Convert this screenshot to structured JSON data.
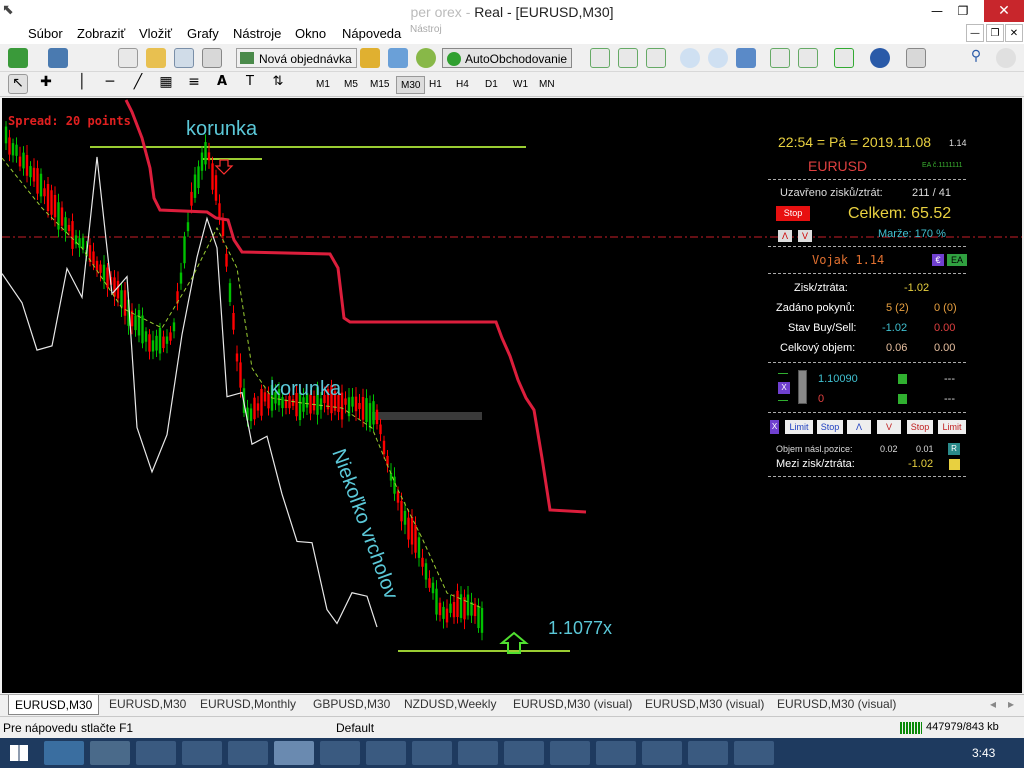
{
  "window": {
    "title_fragment": "Real - [EURUSD,M30]",
    "title_prefix": "per orex -"
  },
  "menu": [
    "Súbor",
    "Zobraziť",
    "Vložiť",
    "Grafy",
    "Nástroje",
    "Okno",
    "Nápoveda"
  ],
  "menu_ghost": "Nástroj",
  "toolbar": {
    "new_order": "Nová objednávka",
    "autotrading": "AutoObchodovanie"
  },
  "timeframes": [
    "M1",
    "M5",
    "M15",
    "M30",
    "H1",
    "H4",
    "D1",
    "W1",
    "MN"
  ],
  "timeframe_selected": "M30",
  "chart": {
    "spread": "Spread: 20 points",
    "annotations": {
      "korunka1": "korunka",
      "korunka2": "korunka",
      "vertical": "Niekoľko vrcholov",
      "price": "1.1077x"
    }
  },
  "panel": {
    "time": "22:54 = Pá = 2019.11.08",
    "version_small": "1.14",
    "symbol": "EURUSD",
    "ea_id": "EA č.1111111",
    "closed_label": "Uzavřeno zisků/ztrát:",
    "closed_value": "211 / 41",
    "stop_btn": "Stop",
    "total": "Celkem: 65.52",
    "a_btn": "Λ",
    "v_btn": "V",
    "margin": "Marže: 170 %",
    "vojak": "Vojak 1.14",
    "e_btn": "€",
    "ea_btn": "EA",
    "pl_label": "Zisk/ztráta:",
    "pl_value": "-1.02",
    "orders_label": "Zadáno pokynů:",
    "orders_buy": "5 (2)",
    "orders_sell": "0 (0)",
    "state_label": "Stav Buy/Sell:",
    "state_buy": "-1.02",
    "state_sell": "0.00",
    "volume_label": "Celkový objem:",
    "volume_buy": "0.06",
    "volume_sell": "0.00",
    "x_btn": "X",
    "line1_value": "1.10090",
    "line1_right": "---",
    "line2_value": "0",
    "line2_right": "---",
    "btns": [
      "X",
      "Limit",
      "Stop",
      "Λ",
      "V",
      "Stop",
      "Limit"
    ],
    "next_vol_label": "Objem násl.pozice:",
    "next_vol_a": "0.02",
    "next_vol_b": "0.01",
    "r_btn": "R",
    "between_label": "Mezi zisk/ztráta:",
    "between_value": "-1.02"
  },
  "tabs": [
    "EURUSD,M30",
    "EURUSD,M30",
    "EURUSD,Monthly",
    "GBPUSD,M30",
    "NZDUSD,Weekly",
    "EURUSD,M30 (visual)",
    "EURUSD,M30 (visual)",
    "EURUSD,M30 (visual)"
  ],
  "status": {
    "help": "Pre nápovedu stlačte F1",
    "profile": "Default",
    "traffic": "447979/843 kb"
  },
  "taskbar": {
    "clock": "3:43"
  },
  "colors": {
    "chart_bg": "#000000",
    "bull": "#00c000",
    "bear": "#ff0000",
    "trail": "#dc1e3c",
    "level": "#9acd32",
    "annot": "#5bc8d8"
  }
}
